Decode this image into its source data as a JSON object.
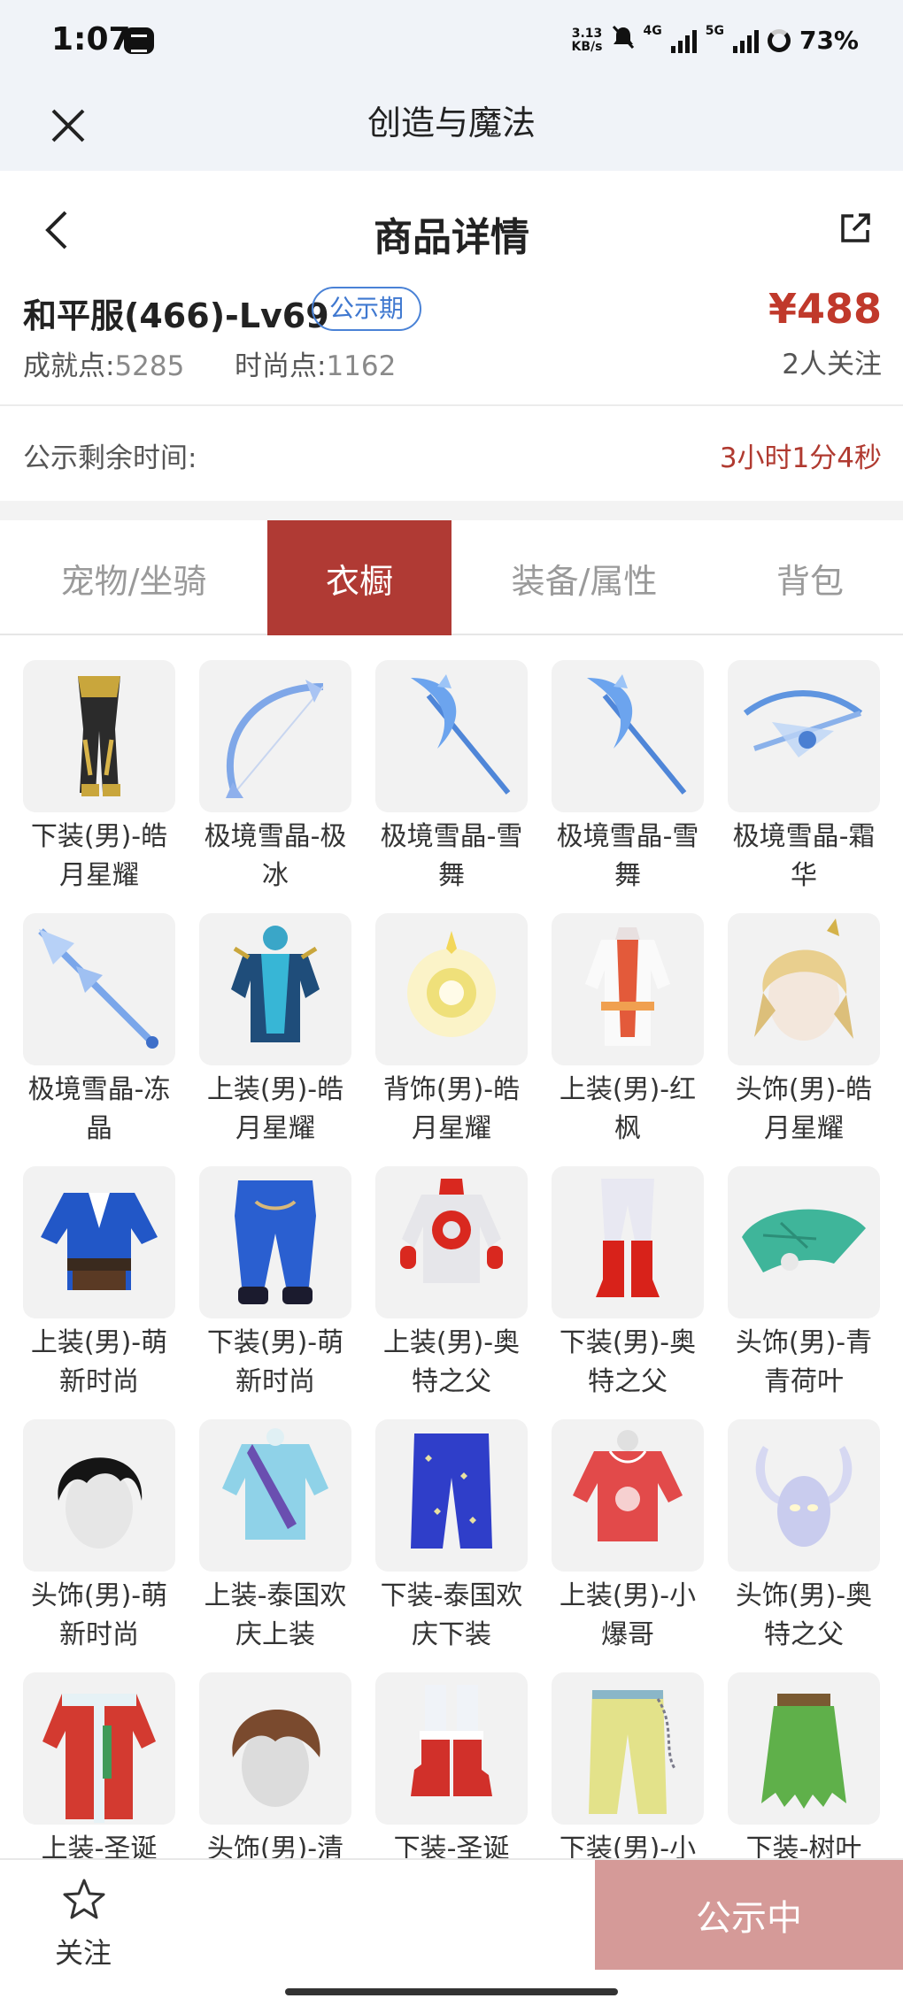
{
  "status_bar": {
    "time": "1:07",
    "speed_top": "3.13",
    "speed_bottom": "KB/s",
    "net1": "4G",
    "net2": "5G",
    "battery": "73%"
  },
  "mini_program": {
    "title": "创造与魔法"
  },
  "nav": {
    "title": "商品详情"
  },
  "product": {
    "name": "和平服(466)-Lv69",
    "badge": "公示期",
    "price": "¥488",
    "achievement_label": "成就点:",
    "achievement_value": "5285",
    "fashion_label": "时尚点:",
    "fashion_value": "1162",
    "followers": "2人关注"
  },
  "countdown": {
    "label": "公示剩余时间:",
    "value": "3小时1分4秒"
  },
  "tabs": [
    {
      "label": "宠物/坐骑",
      "active": false
    },
    {
      "label": "衣橱",
      "active": true
    },
    {
      "label": "装备/属性",
      "active": false
    },
    {
      "label": "背包",
      "active": false
    }
  ],
  "items": [
    {
      "name": "下装(男)-皓月星耀",
      "icon": "gold-black-pants-icon"
    },
    {
      "name": "极境雪晶-极冰",
      "icon": "ice-bow-icon"
    },
    {
      "name": "极境雪晶-雪舞",
      "icon": "ice-scythe-icon"
    },
    {
      "name": "极境雪晶-雪舞",
      "icon": "ice-scythe-icon"
    },
    {
      "name": "极境雪晶-霜华",
      "icon": "ice-crossbow-icon"
    },
    {
      "name": "极境雪晶-冻晶",
      "icon": "ice-spear-icon"
    },
    {
      "name": "上装(男)-皓月星耀",
      "icon": "blue-armor-top-icon"
    },
    {
      "name": "背饰(男)-皓月星耀",
      "icon": "golden-orb-icon"
    },
    {
      "name": "上装(男)-红枫",
      "icon": "red-white-robe-icon"
    },
    {
      "name": "头饰(男)-皓月星耀",
      "icon": "blonde-head-icon"
    },
    {
      "name": "上装(男)-萌新时尚",
      "icon": "blue-kimono-top-icon"
    },
    {
      "name": "下装(男)-萌新时尚",
      "icon": "blue-pants-icon"
    },
    {
      "name": "上装(男)-奥特之父",
      "icon": "hero-suit-top-icon"
    },
    {
      "name": "下装(男)-奥特之父",
      "icon": "red-boots-pants-icon"
    },
    {
      "name": "头饰(男)-青青荷叶",
      "icon": "lotus-leaf-hat-icon"
    },
    {
      "name": "头饰(男)-萌新时尚",
      "icon": "black-hair-head-icon"
    },
    {
      "name": "上装-泰国欢庆上装",
      "icon": "thai-top-icon"
    },
    {
      "name": "下装-泰国欢庆下装",
      "icon": "thai-pants-icon"
    },
    {
      "name": "上装(男)-小爆哥",
      "icon": "red-hoodie-icon"
    },
    {
      "name": "头饰(男)-奥特之父",
      "icon": "horned-mask-icon"
    },
    {
      "name": "上装-圣诞",
      "icon": "christmas-coat-icon"
    },
    {
      "name": "头饰(男)-清",
      "icon": "brown-hair-head-icon"
    },
    {
      "name": "下装-圣诞",
      "icon": "christmas-boots-icon"
    },
    {
      "name": "下装(男)-小",
      "icon": "yellow-pants-icon"
    },
    {
      "name": "下装-树叶",
      "icon": "leaf-skirt-icon"
    }
  ],
  "bottom": {
    "follow_label": "关注",
    "status_button": "公示中"
  },
  "colors": {
    "accent_red": "#b03a34",
    "price_red": "#c0392b",
    "badge_blue": "#3f78d0",
    "button_disabled": "#d59a98"
  }
}
